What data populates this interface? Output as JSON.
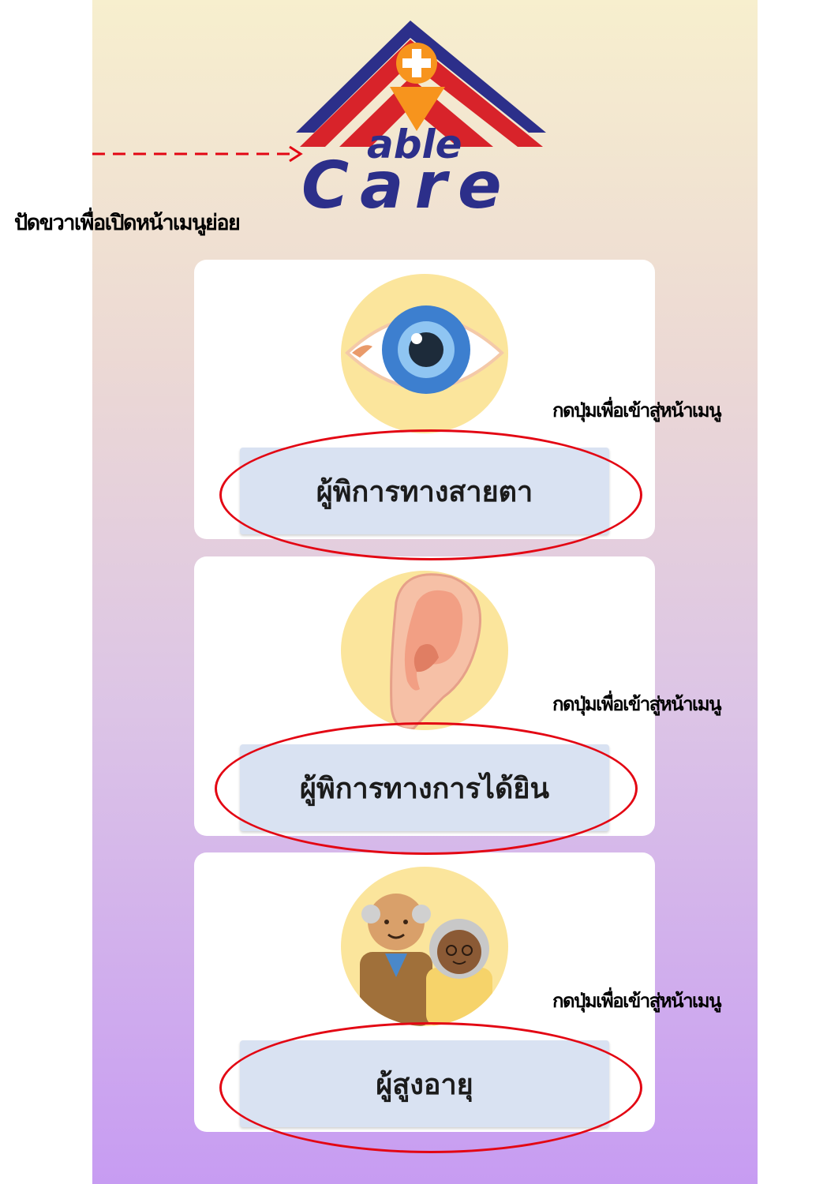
{
  "logo": {
    "line1": "able",
    "line2": "Care"
  },
  "annotations": {
    "swipe_hint": "ปัดขวาเพื่อเปิดหน้าเมนูย่อย",
    "press_hint": "กดปุ่มเพื่อเข้าสู่หน้าเมนู"
  },
  "menu": {
    "items": [
      {
        "label": "ผู้พิการทางสายตา",
        "icon": "eye-icon"
      },
      {
        "label": "ผู้พิการทางการได้ยิน",
        "icon": "ear-icon"
      },
      {
        "label": "ผู้สูงอายุ",
        "icon": "elderly-couple-icon"
      }
    ]
  },
  "colors": {
    "annotation_red": "#e30613",
    "roof_red": "#d8232a",
    "roof_navy": "#2c2f8a",
    "logo_orange": "#f7941d",
    "button_bg": "#d9e2f2",
    "icon_circle": "#fbe59c"
  }
}
